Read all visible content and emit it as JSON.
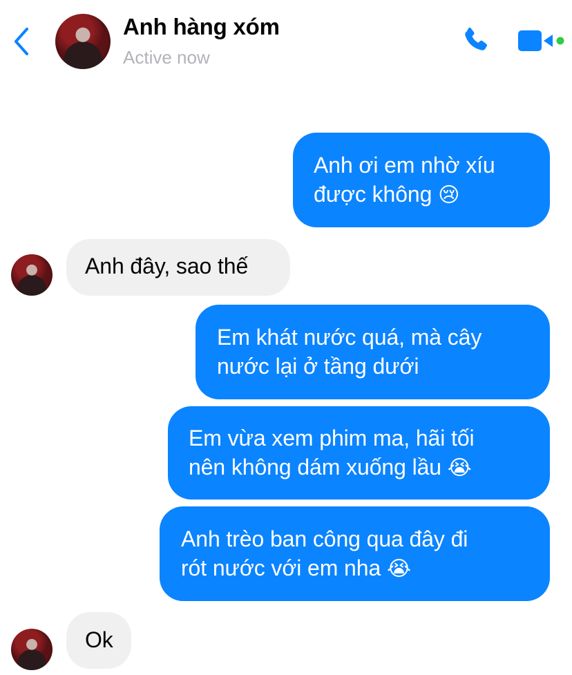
{
  "header": {
    "contact_name": "Anh hàng xóm",
    "status": "Active now",
    "accent_color": "#0b84ff",
    "icons": [
      "back-chevron-icon",
      "phone-icon",
      "video-icon",
      "online-dot-icon"
    ]
  },
  "messages": [
    {
      "side": "out",
      "line1": "Anh ơi em nhờ xíu",
      "line2": "được không",
      "emoji": "😢"
    },
    {
      "side": "in",
      "text": "Anh đây, sao thế"
    },
    {
      "side": "out",
      "line1": "Em khát nước quá, mà cây",
      "line2": "nước lại ở tầng dưới"
    },
    {
      "side": "out",
      "line1": "Em vừa xem phim ma, hãi tối",
      "line2": "nên không dám xuống lầu",
      "emoji": "😭"
    },
    {
      "side": "out",
      "line1": "Anh trèo ban công qua đây đi",
      "line2": "rót nước với em nha",
      "emoji": "😭"
    },
    {
      "side": "in",
      "text": "Ok"
    }
  ]
}
